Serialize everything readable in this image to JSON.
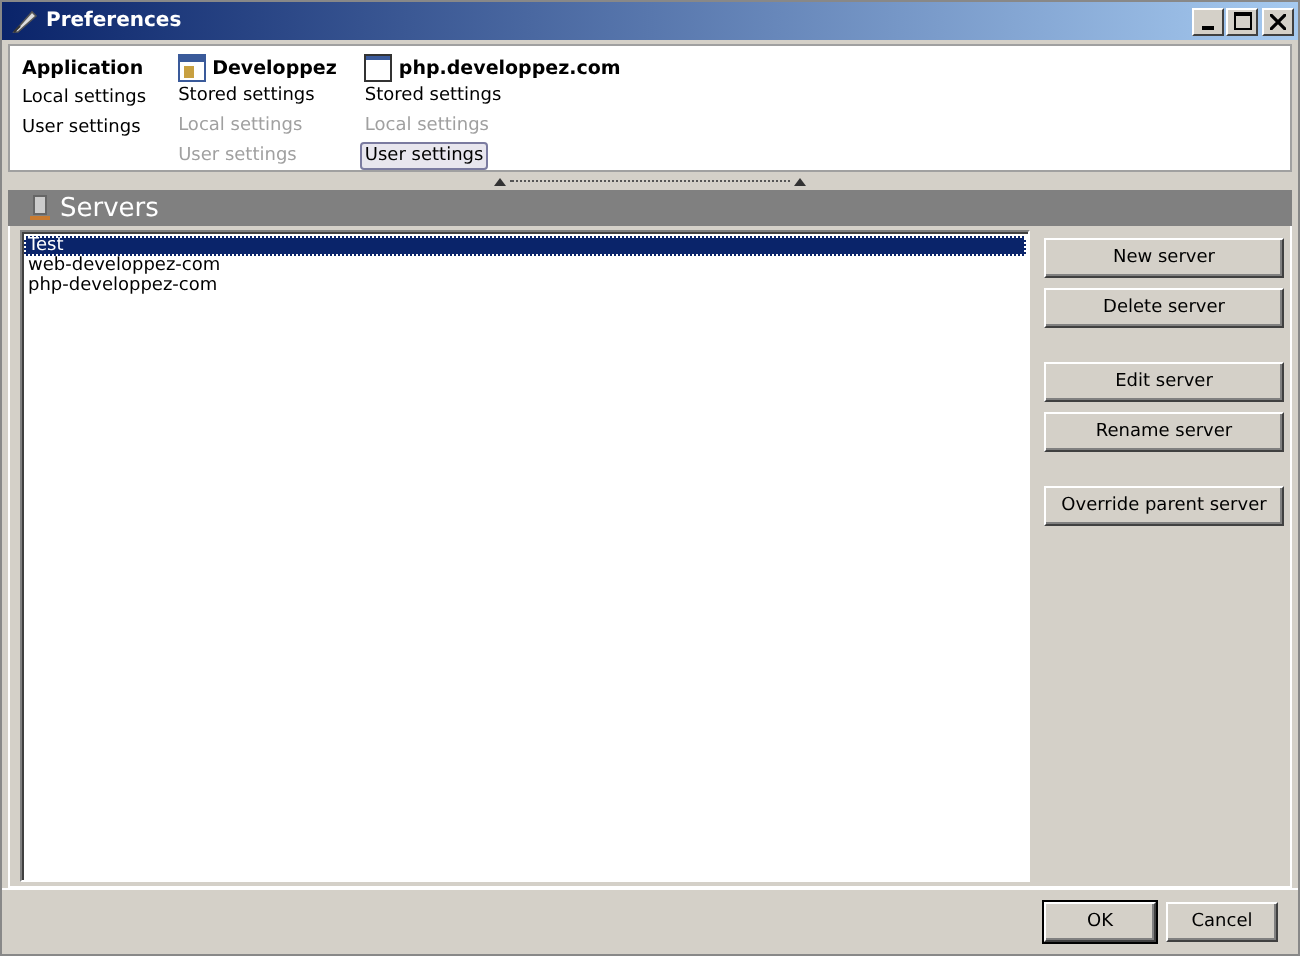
{
  "window": {
    "title": "Preferences"
  },
  "scopes": [
    {
      "name": "Application",
      "kind": "text",
      "items": [
        {
          "label": "Local settings",
          "disabled": false,
          "selected": false
        },
        {
          "label": "User settings",
          "disabled": false,
          "selected": false
        }
      ]
    },
    {
      "name": "Developpez",
      "kind": "project",
      "items": [
        {
          "label": "Stored settings",
          "disabled": false,
          "selected": false
        },
        {
          "label": "Local settings",
          "disabled": true,
          "selected": false
        },
        {
          "label": "User settings",
          "disabled": true,
          "selected": false
        }
      ]
    },
    {
      "name": "php.developpez.com",
      "kind": "site",
      "items": [
        {
          "label": "Stored settings",
          "disabled": false,
          "selected": false
        },
        {
          "label": "Local settings",
          "disabled": true,
          "selected": false
        },
        {
          "label": "User settings",
          "disabled": false,
          "selected": true
        }
      ]
    }
  ],
  "panel": {
    "title": "Servers"
  },
  "servers": [
    {
      "name": "Test",
      "selected": true
    },
    {
      "name": "web-developpez-com",
      "selected": false
    },
    {
      "name": "php-developpez-com",
      "selected": false
    }
  ],
  "action_groups": [
    [
      "New server",
      "Delete server"
    ],
    [
      "Edit server",
      "Rename server"
    ],
    [
      "Override parent server"
    ]
  ],
  "buttons": [
    {
      "label": "OK",
      "default": true
    },
    {
      "label": "Cancel",
      "default": false
    }
  ]
}
